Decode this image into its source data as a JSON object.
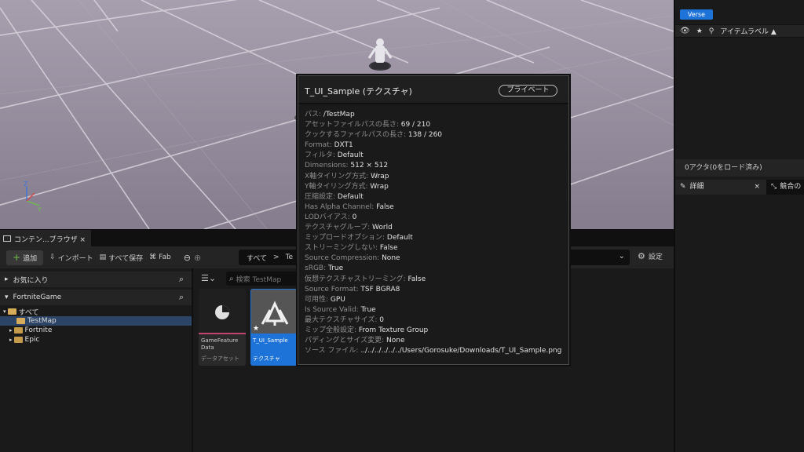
{
  "right_panel": {
    "verse_label": "Verse",
    "outliner_column": "アイテムラベル ▲",
    "actor_count": "0アクタ(0をロード済み)",
    "details_tab": "詳細",
    "details_close": "×",
    "second_tab": "競合の"
  },
  "content_browser": {
    "tab_label": "コンテン...ブラウザ ×",
    "toolbar": {
      "add": "追加",
      "import": "インポート",
      "save_all": "すべて保存",
      "fab": "Fab",
      "path_root": "すべて",
      "path_arrow": ">",
      "path_child": "Te",
      "settings": "設定"
    },
    "favorites": "お気に入り",
    "project": "FortniteGame",
    "tree": {
      "all": "すべて",
      "testmap": "TestMap",
      "fortnite": "Fortnite",
      "epic": "Epic"
    },
    "search_placeholder": "検索 TestMap",
    "assets": [
      {
        "name": "GameFeature Data",
        "type": "データアセット"
      },
      {
        "name": "T_UI_Sample",
        "type": "テクスチャ"
      }
    ]
  },
  "tooltip": {
    "title": "T_UI_Sample (テクスチャ)",
    "badge": "プライベート",
    "rows": [
      {
        "k": "パス: ",
        "v": "/TestMap"
      },
      {
        "k": "アセットファイルパスの長さ: ",
        "v": "69 / 210"
      },
      {
        "k": "クックするファイルパスの長さ: ",
        "v": "138 / 260"
      },
      {
        "k": "Format: ",
        "v": "DXT1"
      },
      {
        "k": "フィルタ: ",
        "v": "Default"
      },
      {
        "k": "Dimensions: ",
        "v": "512 × 512"
      },
      {
        "k": "X軸タイリング方式: ",
        "v": "Wrap"
      },
      {
        "k": "Y軸タイリング方式: ",
        "v": "Wrap"
      },
      {
        "k": "圧縮設定: ",
        "v": "Default"
      },
      {
        "k": "Has Alpha Channel: ",
        "v": "False"
      },
      {
        "k": "LODバイアス: ",
        "v": "0"
      },
      {
        "k": "テクスチャグループ: ",
        "v": "World"
      },
      {
        "k": "ミップロードオプション: ",
        "v": "Default"
      },
      {
        "k": "ストリーミングしない: ",
        "v": "False"
      },
      {
        "k": "Source Compression: ",
        "v": "None"
      },
      {
        "k": "sRGB: ",
        "v": "True"
      },
      {
        "k": "仮想テクスチャストリーミング: ",
        "v": "False"
      },
      {
        "k": "Source Format: ",
        "v": "TSF BGRA8"
      },
      {
        "k": "可用性: ",
        "v": "GPU"
      },
      {
        "k": "Is Source Valid: ",
        "v": "True"
      },
      {
        "k": "最大テクスチャサイズ: ",
        "v": "0"
      },
      {
        "k": "ミップ全般設定: ",
        "v": "From Texture Group"
      },
      {
        "k": "パディングとサイズ変更: ",
        "v": "None"
      },
      {
        "k": "ソース ファイル: ",
        "v": "../../../../../../Users/Gorosuke/Downloads/T_UI_Sample.png"
      }
    ]
  },
  "colors": {
    "accent": "#1e73d8",
    "selection": "#2c4466",
    "folder": "#c59a4b"
  }
}
